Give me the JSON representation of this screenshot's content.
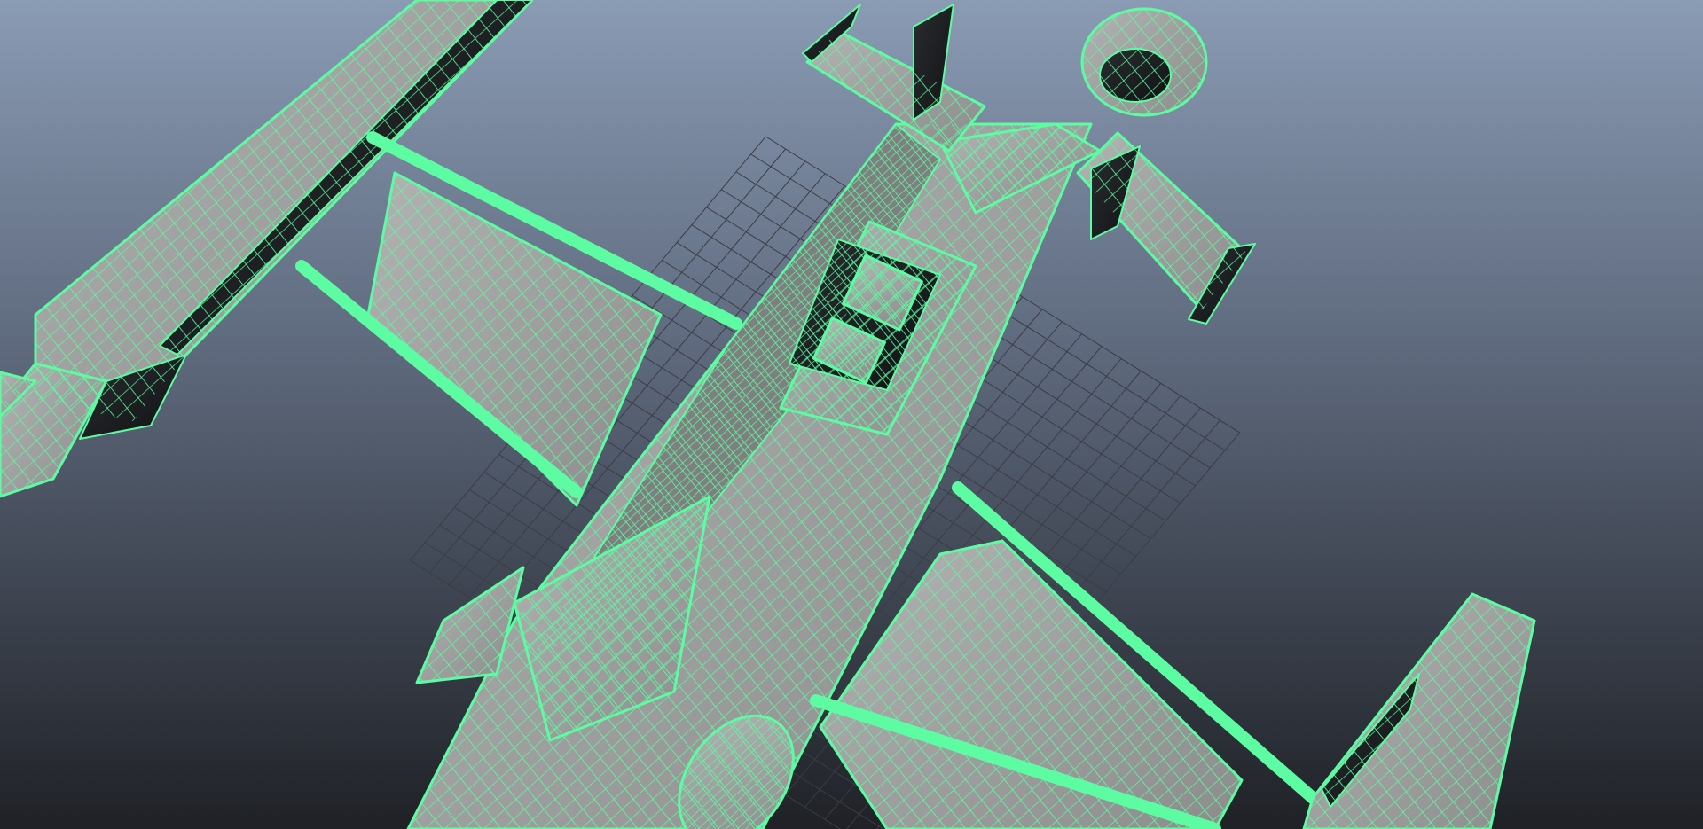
{
  "viewport": {
    "background_top": "#8a9bb4",
    "background_bottom": "#1f2126",
    "grid_color": "#3a3d44"
  },
  "model": {
    "wire_color": "#5dfca2",
    "surface_color": "#a2a2a2",
    "surface_shade": "#7f7f7f",
    "dark_shade": "#1d1f22"
  }
}
